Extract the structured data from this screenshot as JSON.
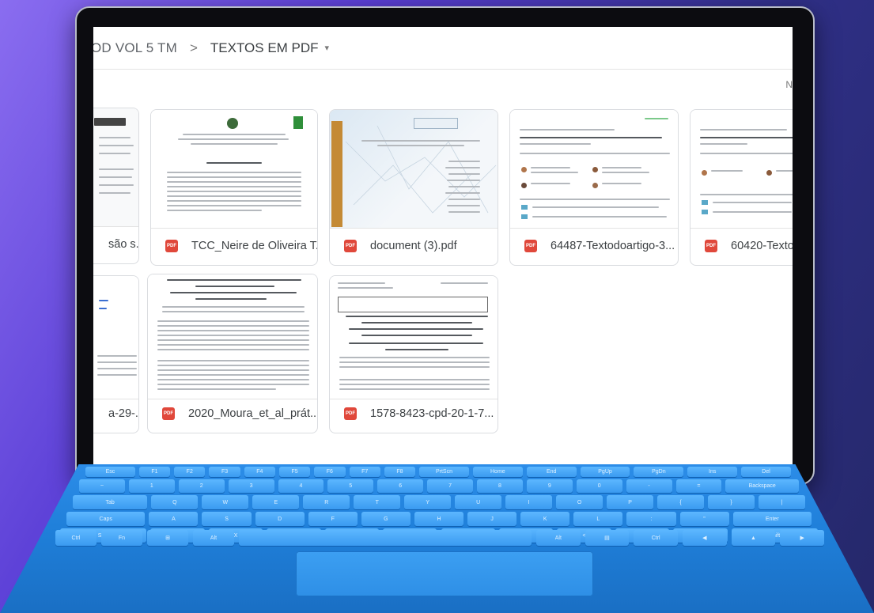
{
  "breadcrumb": {
    "parent": "OD VOL 5 TM",
    "separator": ">",
    "current": "TEXTOS EM PDF",
    "caret": "▾"
  },
  "corner_glyph": "N",
  "files_row1": [
    {
      "name": "são s..."
    },
    {
      "name": "TCC_Neire de Oliveira T..."
    },
    {
      "name": "document (3).pdf"
    },
    {
      "name": "64487-Textodoartigo-3..."
    },
    {
      "name": "60420-Texto"
    }
  ],
  "files_row2": [
    {
      "name": "a-29-..."
    },
    {
      "name": "2020_Moura_et_al_prát..."
    },
    {
      "name": "1578-8423-cpd-20-1-7..."
    }
  ],
  "pdf_badge": "PDF",
  "keyboard_labels": {
    "row1": [
      "Esc",
      "F1",
      "F2",
      "F3",
      "F4",
      "F5",
      "F6",
      "F7",
      "F8",
      "PrtScn",
      "Home",
      "End",
      "PgUp",
      "PgDn",
      "Ins",
      "Del"
    ],
    "row2": [
      "~",
      "1",
      "2",
      "3",
      "4",
      "5",
      "6",
      "7",
      "8",
      "9",
      "0",
      "-",
      "=",
      "Backspace"
    ],
    "row3": [
      "Tab",
      "Q",
      "W",
      "E",
      "R",
      "T",
      "Y",
      "U",
      "I",
      "O",
      "P",
      "{",
      "}",
      "|"
    ],
    "row4": [
      "Caps",
      "A",
      "S",
      "D",
      "F",
      "G",
      "H",
      "J",
      "K",
      "L",
      ":",
      "\"",
      "Enter"
    ],
    "row5": [
      "Shift",
      "Z",
      "X",
      "C",
      "V",
      "B",
      "N",
      "M",
      "<",
      ">",
      "?",
      "Shift"
    ],
    "row6": [
      "Ctrl",
      "Fn",
      "⊞",
      "Alt",
      "",
      "Alt",
      "▤",
      "Ctrl",
      "◀",
      "▲",
      "▶"
    ]
  }
}
